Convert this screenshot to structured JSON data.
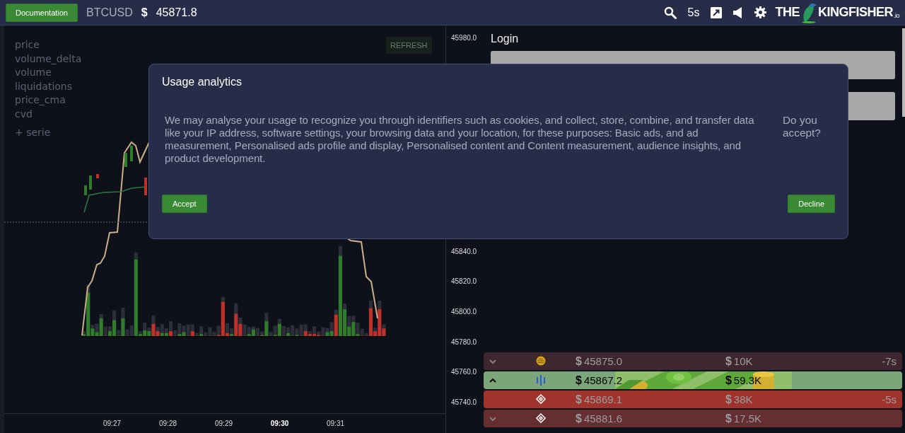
{
  "topbar": {
    "doc_button": "Documentation",
    "symbol": "BTCUSD",
    "currency": "$",
    "price": "45871.8",
    "interval": "5s",
    "logo": {
      "left": "THE",
      "right": "KINGFISHER",
      "suffix": ".io"
    }
  },
  "chart": {
    "series": [
      {
        "label": "price"
      },
      {
        "label": "volume_delta"
      },
      {
        "label": "volume"
      },
      {
        "label": "liquidations"
      },
      {
        "label": "price_cma"
      },
      {
        "label": "cvd"
      }
    ],
    "add_series": "+ serie",
    "refresh": "REFRESH",
    "y_axis_labels": [
      "45980.0",
      "45840.0",
      "45820.0",
      "45800.0",
      "45780.0",
      "45760.0",
      "45740.0"
    ],
    "x_axis_labels": [
      {
        "label": "09:27",
        "bold": false
      },
      {
        "label": "09:28",
        "bold": false
      },
      {
        "label": "09:29",
        "bold": false
      },
      {
        "label": "09:30",
        "bold": true
      },
      {
        "label": "09:31",
        "bold": false
      }
    ]
  },
  "login": {
    "title": "Login"
  },
  "trades": [
    {
      "chevron": true,
      "expanded": false,
      "kind": "coin",
      "price_currency": "$",
      "price": "45875.0",
      "amount_currency": "$",
      "amount": "10K",
      "age": "-7s",
      "color": "#3f272f",
      "has_picture": false,
      "highlight": false
    },
    {
      "chevron": true,
      "expanded": true,
      "kind": "bars",
      "price_currency": "$",
      "price": "45867.2",
      "amount_currency": "$",
      "amount": "59.3K",
      "color": "#7aa67a",
      "has_picture": true,
      "highlight": true
    },
    {
      "chevron": false,
      "kind": "diamond",
      "price_currency": "$",
      "price": "45869.1",
      "amount_currency": "$",
      "amount": "38K",
      "age": "-5s",
      "color": "#a0332c",
      "has_picture": false,
      "highlight": false
    },
    {
      "chevron": true,
      "expanded": false,
      "kind": "diamond",
      "price_currency": "$",
      "price": "45881.6",
      "amount_currency": "$",
      "amount": "17.5K",
      "color": "#652e31",
      "has_picture": false,
      "highlight": false
    }
  ],
  "dialog": {
    "title": "Usage analytics",
    "message": "We may analyse your usage to recognize you through identifiers such as cookies, and collect, store, combine, and transfer data like your IP address, software settings, your browsing data and your location, for these purposes: Basic ads, and ad measurement, Personalised ads profile and display, Personalised content and Content measurement, audience insights, and product development.",
    "question": "Do you accept?",
    "buttons": [
      "Accept",
      "Decline"
    ]
  }
}
